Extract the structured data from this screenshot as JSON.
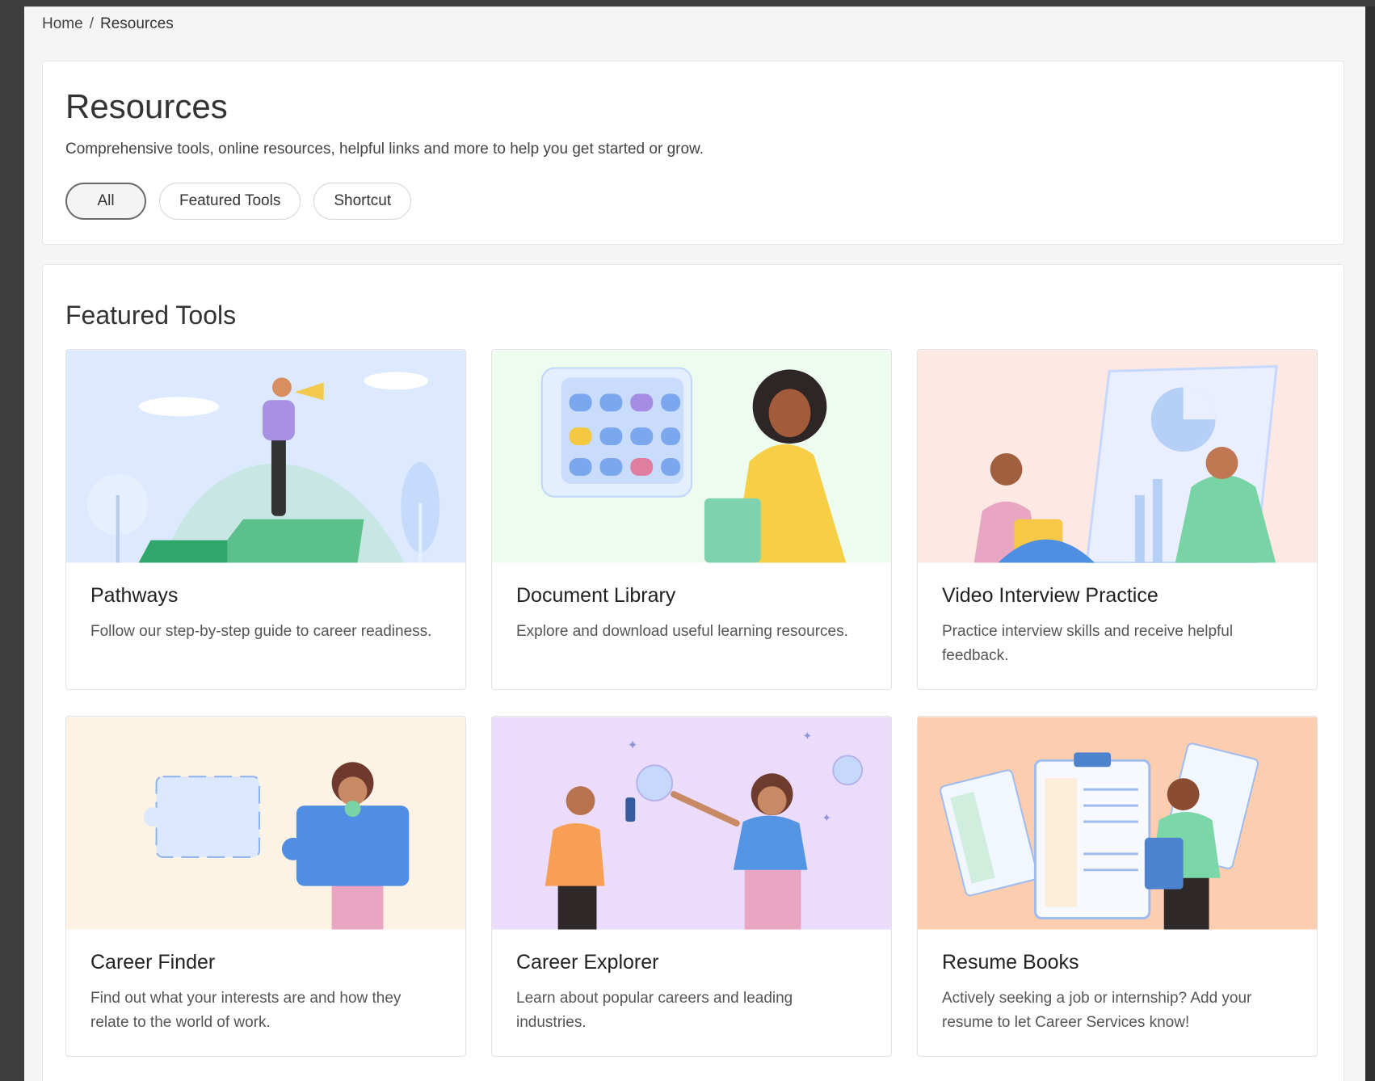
{
  "breadcrumb": {
    "home": "Home",
    "separator": "/",
    "current": "Resources"
  },
  "header": {
    "title": "Resources",
    "subtitle": "Comprehensive tools, online resources, helpful links and more to help you get started or grow."
  },
  "filters": [
    {
      "label": "All",
      "active": true
    },
    {
      "label": "Featured Tools",
      "active": false
    },
    {
      "label": "Shortcut",
      "active": false
    }
  ],
  "featured": {
    "title": "Featured Tools",
    "tools": [
      {
        "name": "Pathways",
        "description": "Follow our step-by-step guide to career readiness.",
        "bg": "#dce9ff"
      },
      {
        "name": "Document Library",
        "description": "Explore and download useful learning resources.",
        "bg": "#eefcef"
      },
      {
        "name": "Video Interview Practice",
        "description": "Practice interview skills and receive helpful feedback.",
        "bg": "#fde8e3"
      },
      {
        "name": "Career Finder",
        "description": "Find out what your interests are and how they relate to the world of work.",
        "bg": "#fdf3e4"
      },
      {
        "name": "Career Explorer",
        "description": "Learn about popular careers and leading industries.",
        "bg": "#ecdcfc"
      },
      {
        "name": "Resume Books",
        "description": "Actively seeking a job or internship? Add your resume to let Career Services know!",
        "bg": "#fdcdb0"
      }
    ]
  }
}
